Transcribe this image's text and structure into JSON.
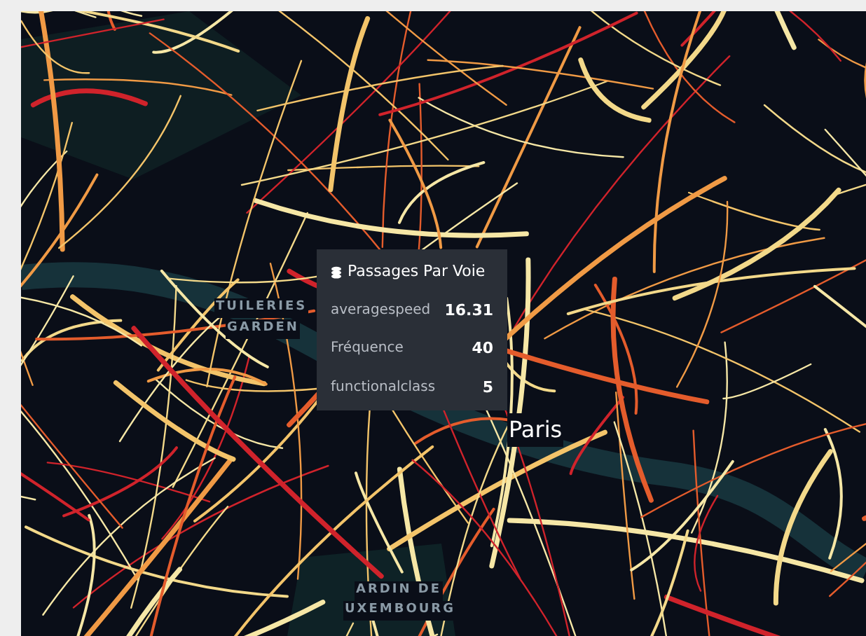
{
  "map": {
    "labels": [
      {
        "text": "TUILERIES",
        "kind": "park"
      },
      {
        "text": "GARDEN",
        "kind": "park"
      },
      {
        "text": "Paris",
        "kind": "city"
      },
      {
        "text": "ARDIN DE",
        "kind": "park"
      },
      {
        "text": "UXEMBOURG",
        "kind": "park"
      }
    ]
  },
  "tooltip": {
    "title": "Passages Par Voie",
    "rows": [
      {
        "label": "averagespeed",
        "value": "16.31"
      },
      {
        "label": "Fréquence",
        "value": "40"
      },
      {
        "label": "functionalclass",
        "value": "5"
      }
    ]
  }
}
